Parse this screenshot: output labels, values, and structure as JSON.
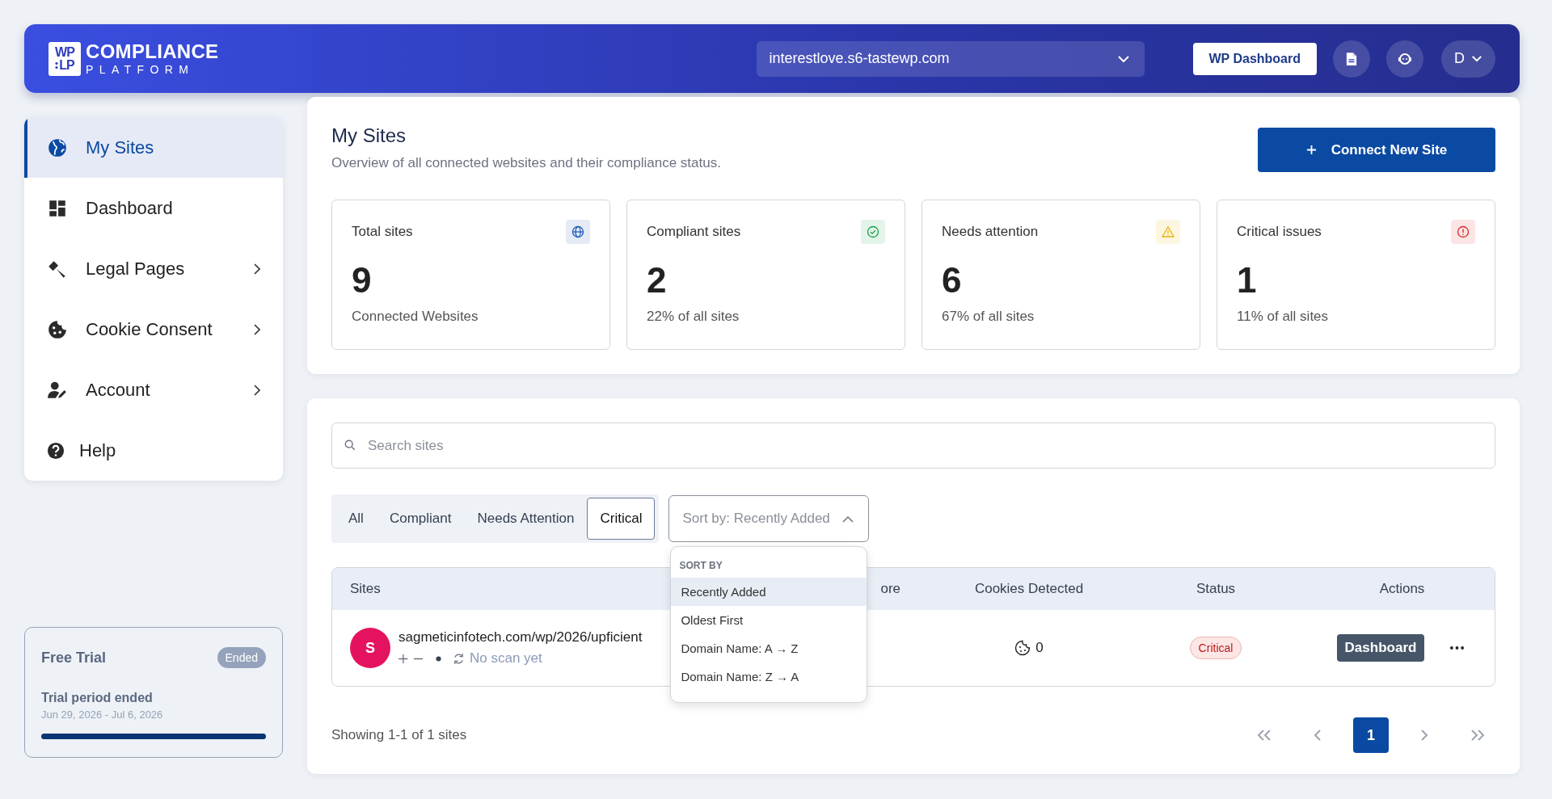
{
  "header": {
    "logo": {
      "mark_top": "WP",
      "mark_bottom": "LP",
      "name": "COMPLIANCE",
      "tagline": "PLATFORM"
    },
    "site_select": {
      "value": "interestlove.s6-tastewp.com"
    },
    "wp_dashboard_button": "WP Dashboard",
    "user": {
      "initial": "D"
    }
  },
  "sidebar": {
    "items": [
      {
        "label": "My Sites",
        "kind": "globe",
        "selected": true,
        "expandable": false
      },
      {
        "label": "Dashboard",
        "kind": "dashboard",
        "selected": false,
        "expandable": false
      },
      {
        "label": "Legal Pages",
        "kind": "gavel",
        "selected": false,
        "expandable": true
      },
      {
        "label": "Cookie Consent",
        "kind": "cookie",
        "selected": false,
        "expandable": true
      },
      {
        "label": "Account",
        "kind": "user-edit",
        "selected": false,
        "expandable": true
      },
      {
        "label": "Help",
        "kind": "help",
        "selected": false,
        "expandable": false
      }
    ],
    "trial": {
      "title": "Free Trial",
      "badge": "Ended",
      "status": "Trial period ended",
      "dates": "Jun 29, 2026 - Jul 6, 2026",
      "level": 1
    }
  },
  "overview": {
    "title": "My Sites",
    "subtitle": "Overview of all connected websites and their compliance status.",
    "connect_button": "Connect New Site",
    "stats": [
      {
        "label": "Total sites",
        "kind": "globe",
        "color": "#1e5bb8",
        "value": "9",
        "note": "Connected Websites"
      },
      {
        "label": "Compliant sites",
        "kind": "check",
        "color": "#16a34a",
        "value": "2",
        "note": "22% of all sites"
      },
      {
        "label": "Needs attention",
        "kind": "warning",
        "color": "#eab308",
        "value": "6",
        "note": "67% of all sites"
      },
      {
        "label": "Critical issues",
        "kind": "info",
        "color": "#dc2626",
        "value": "1",
        "note": "11% of all sites"
      }
    ]
  },
  "sites": {
    "search": {
      "placeholder": "Search sites"
    },
    "filters": [
      {
        "label": "All",
        "selected": false
      },
      {
        "label": "Compliant",
        "selected": false
      },
      {
        "label": "Needs Attention",
        "selected": false
      },
      {
        "label": "Critical",
        "selected": true
      }
    ],
    "sort": {
      "value": "Sort by: Recently Added",
      "expanded": true,
      "menu_title": "SORT BY",
      "options": [
        {
          "label": "Recently Added",
          "selected": true
        },
        {
          "label": "Oldest First",
          "selected": false
        },
        {
          "label": "Domain Name: A → Z",
          "selected": false
        },
        {
          "label": "Domain Name: Z → A",
          "selected": false
        }
      ]
    },
    "table": {
      "columns": [
        "Sites",
        "ore",
        "Cookies Detected",
        "Status",
        "Actions"
      ],
      "rows": [
        {
          "avatar": "S",
          "color": "#e5135f",
          "site": "sagmeticinfotech.com/wp/2026/upficient",
          "scan": "No scan yet",
          "cookies": "0",
          "status": "Critical",
          "kind": "critical",
          "action": "Dashboard"
        }
      ]
    },
    "footer": {
      "summary": "Showing 1-1 of 1 sites",
      "pages": [
        {
          "label": "1",
          "selected": true
        }
      ]
    }
  }
}
